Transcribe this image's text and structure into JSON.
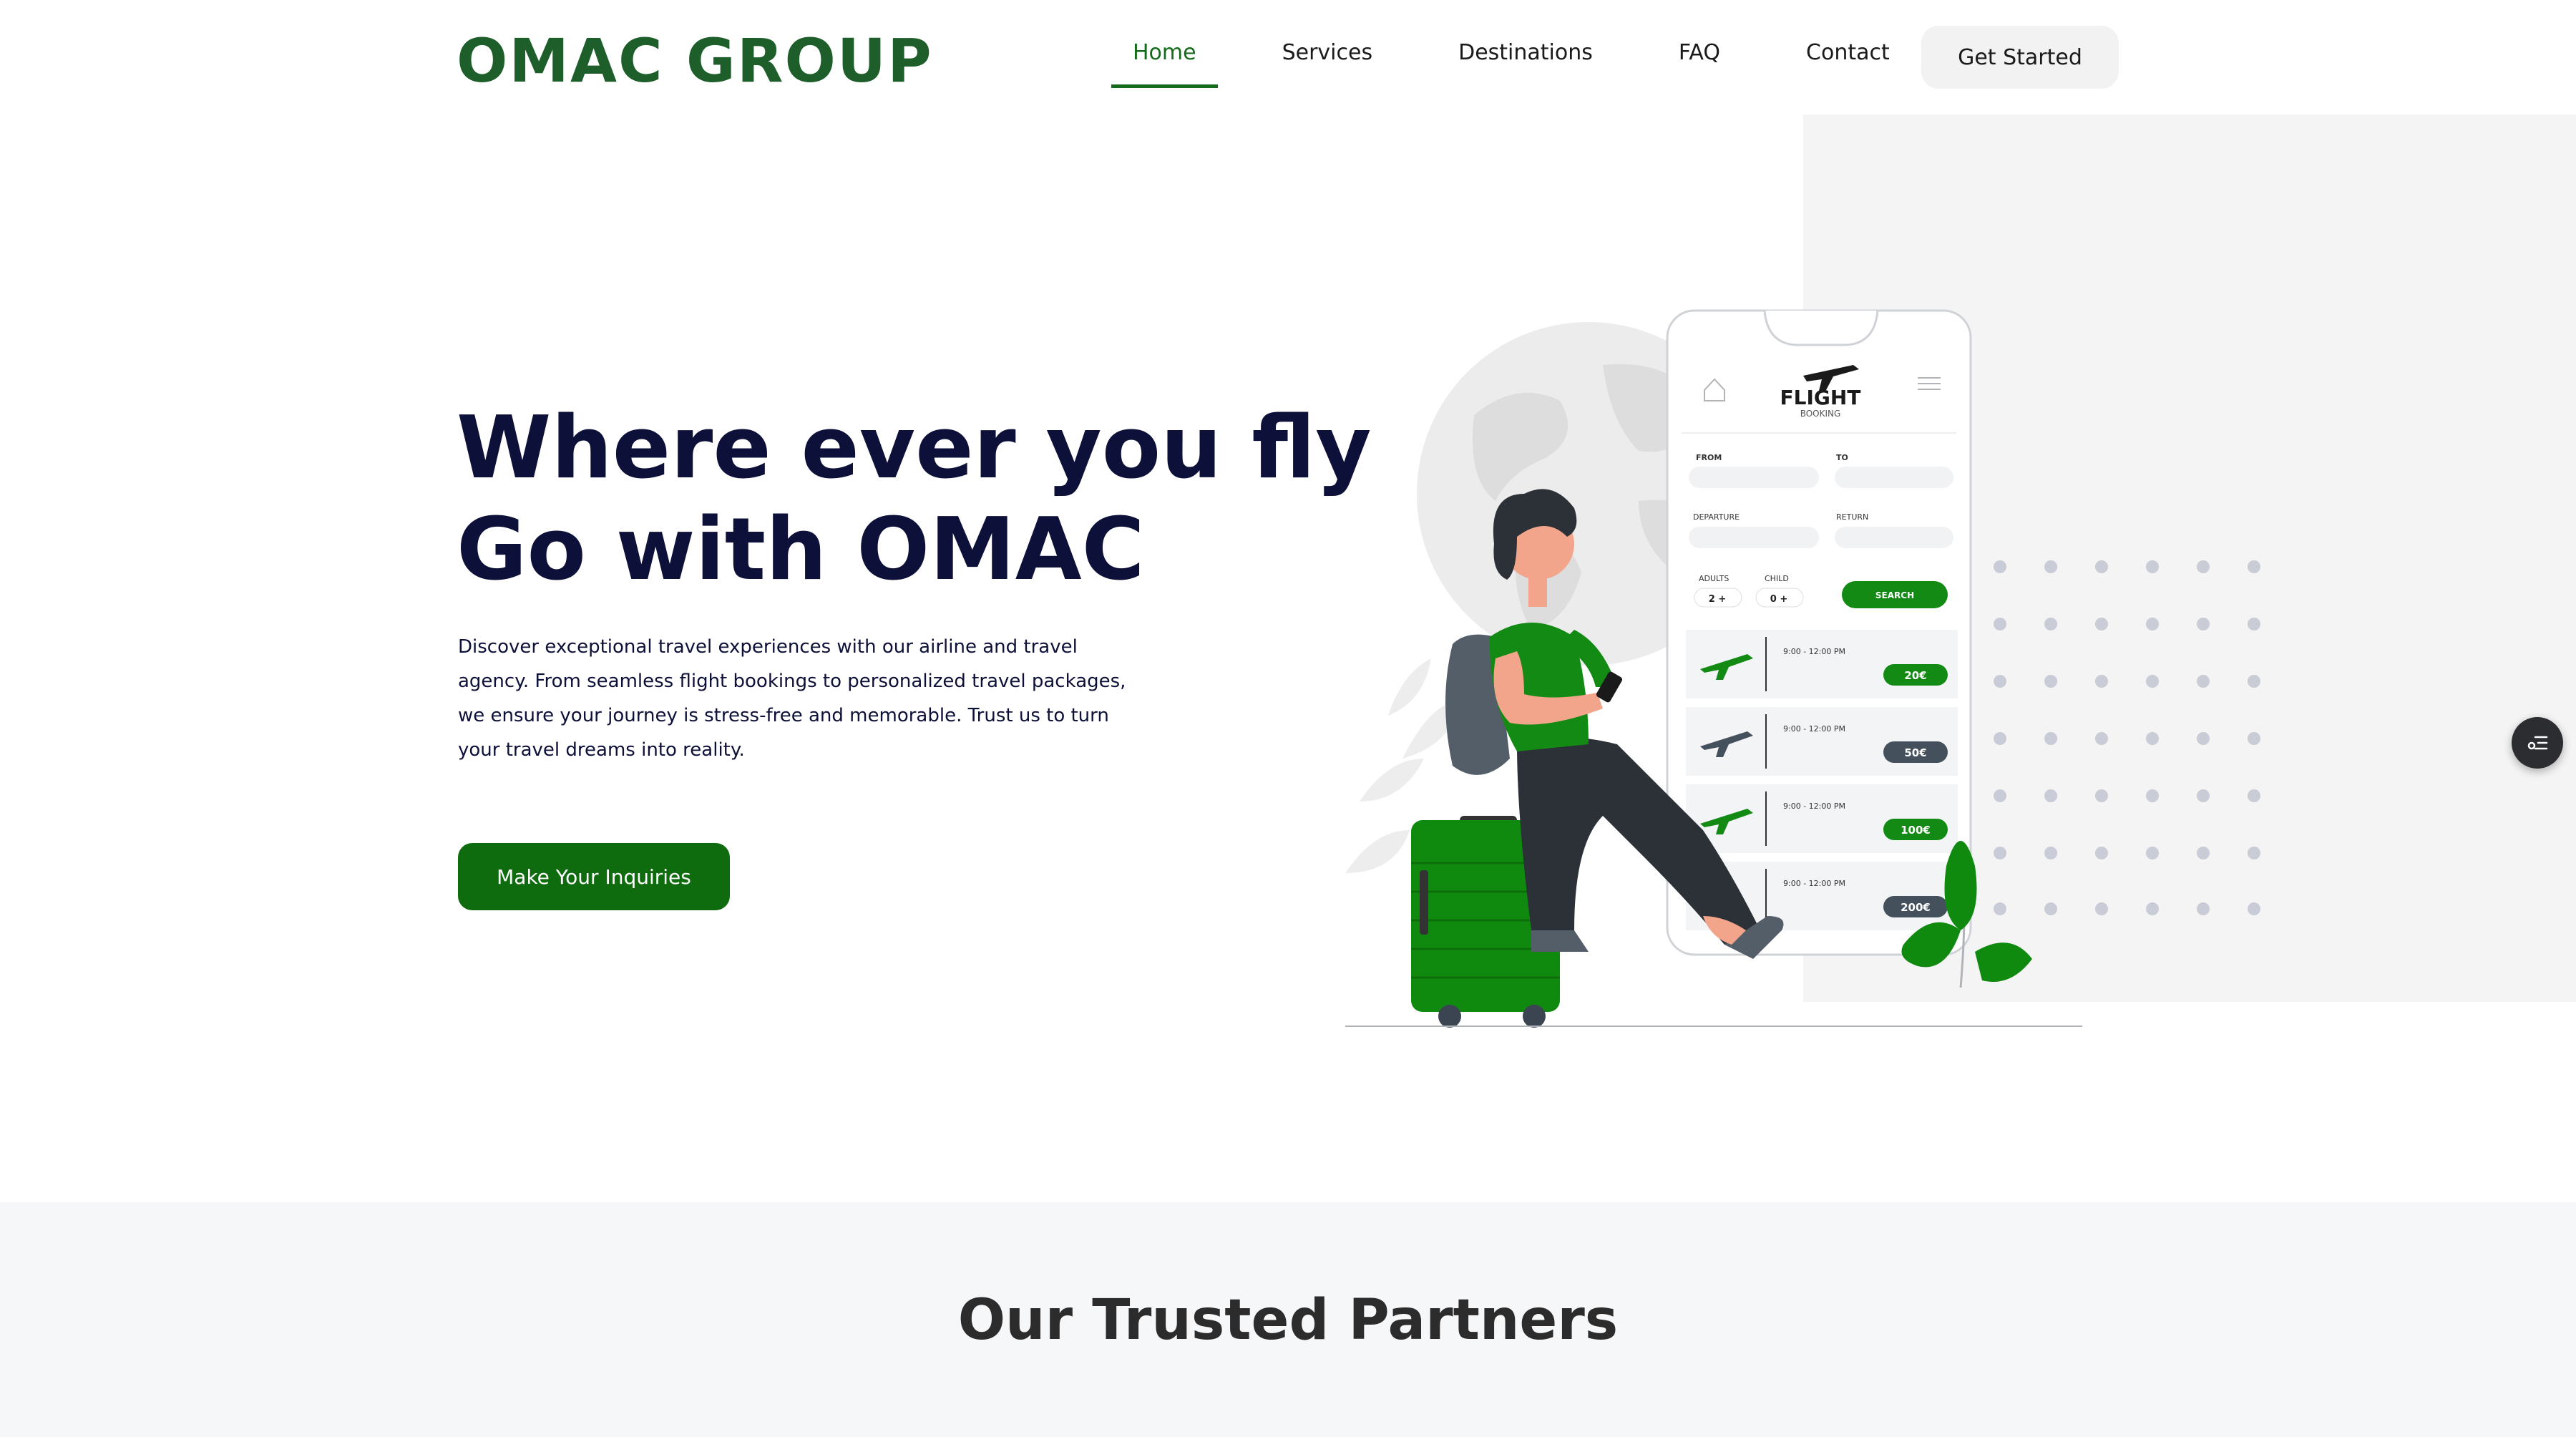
{
  "header": {
    "logo": "OMAC GROUP",
    "nav": [
      {
        "label": "Home",
        "active": true
      },
      {
        "label": "Services"
      },
      {
        "label": "Destinations"
      },
      {
        "label": "FAQ"
      },
      {
        "label": "Contact"
      }
    ],
    "cta": "Get Started"
  },
  "hero": {
    "title_line1": "Where ever you fly",
    "title_line2": "Go with OMAC",
    "description": "Discover exceptional travel experiences with our airline and travel agency. From seamless flight bookings to personalized travel packages, we ensure your journey is stress-free and memorable. Trust us to turn your travel dreams into reality.",
    "button": "Make Your Inquiries"
  },
  "phone": {
    "title": "FLIGHT",
    "subtitle": "BOOKING",
    "from": "FROM",
    "to": "TO",
    "departure": "DEPARTURE",
    "return": "RETURN",
    "adults": "ADULTS",
    "child": "CHILD",
    "adults_value": "2 +",
    "child_value": "0 +",
    "search": "SEARCH",
    "flights": [
      {
        "time": "9:00 - 12:00 PM",
        "price": "20€",
        "color": "#138a13"
      },
      {
        "time": "9:00 - 12:00 PM",
        "price": "50€",
        "color": "#44505c"
      },
      {
        "time": "9:00 - 12:00 PM",
        "price": "100€",
        "color": "#138a13"
      },
      {
        "time": "9:00 - 12:00 PM",
        "price": "200€",
        "color": "#44505c"
      }
    ]
  },
  "partners": {
    "title": "Our Trusted Partners"
  },
  "colors": {
    "brand_green": "#136b1c",
    "navy": "#0d1038"
  },
  "icons": {
    "floating": "settings-sliders-icon"
  }
}
